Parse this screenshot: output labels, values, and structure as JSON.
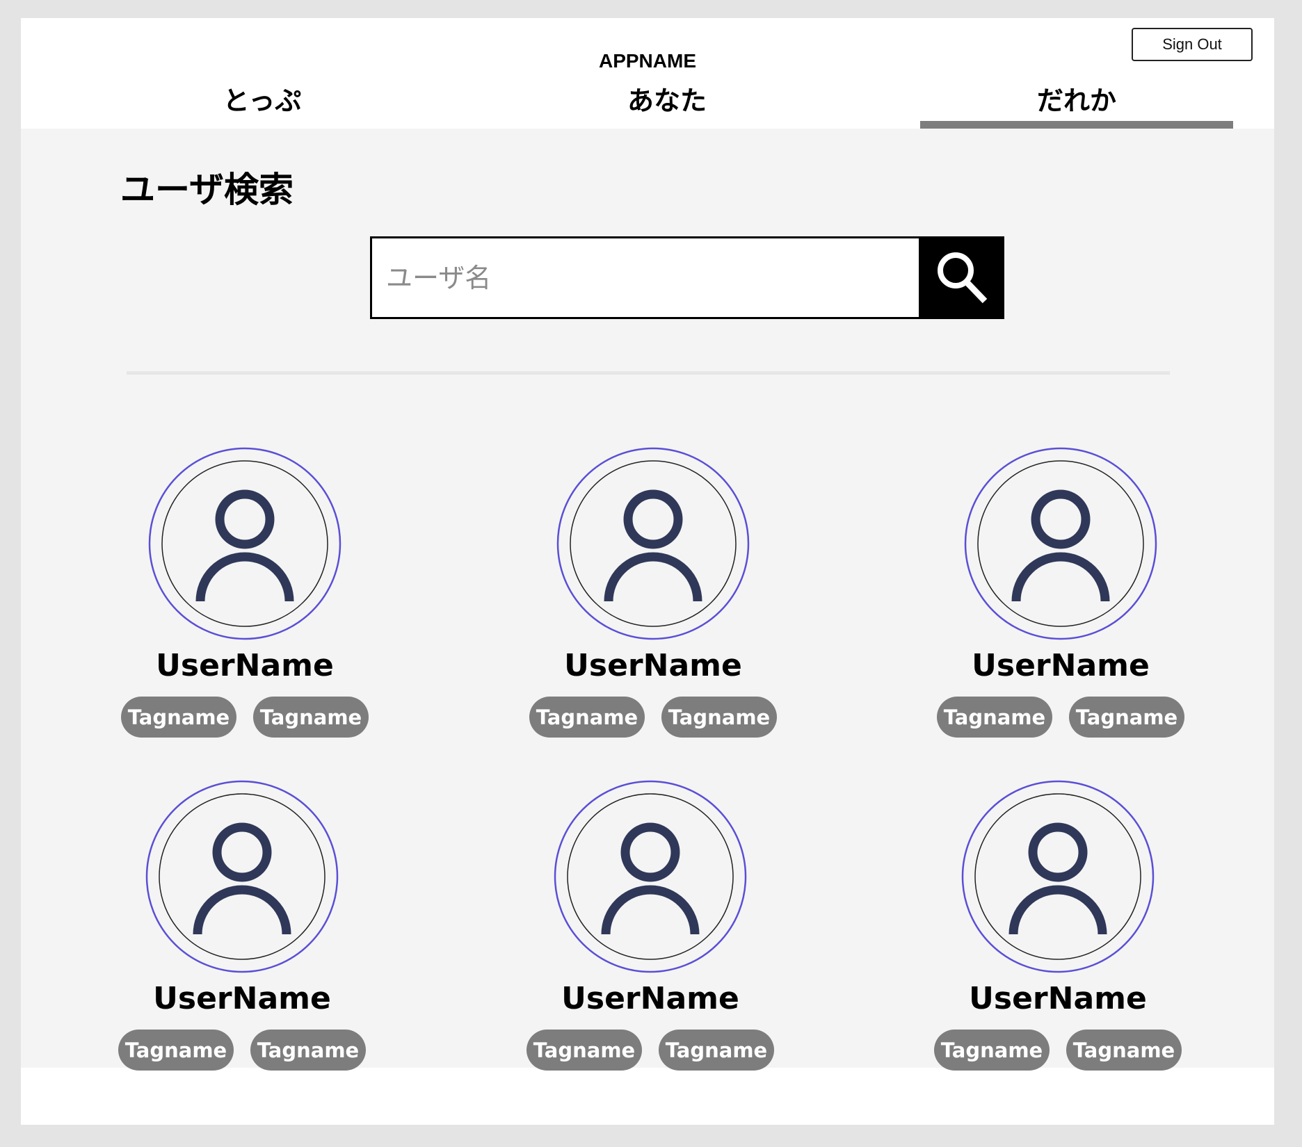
{
  "header": {
    "app_title": "APPNAME",
    "sign_out_label": "Sign Out"
  },
  "tabs": [
    {
      "label": "とっぷ",
      "active": false
    },
    {
      "label": "あなた",
      "active": false
    },
    {
      "label": "だれか",
      "active": true
    }
  ],
  "search": {
    "title": "ユーザ検索",
    "placeholder": "ユーザ名",
    "value": "",
    "button_icon": "search-icon"
  },
  "users": [
    {
      "name": "UserName",
      "tags": [
        "Tagname",
        "Tagname"
      ],
      "avatar_icon": "user-icon"
    },
    {
      "name": "UserName",
      "tags": [
        "Tagname",
        "Tagname"
      ],
      "avatar_icon": "user-icon"
    },
    {
      "name": "UserName",
      "tags": [
        "Tagname",
        "Tagname"
      ],
      "avatar_icon": "user-icon"
    },
    {
      "name": "UserName",
      "tags": [
        "Tagname",
        "Tagname"
      ],
      "avatar_icon": "user-icon"
    },
    {
      "name": "UserName",
      "tags": [
        "Tagname",
        "Tagname"
      ],
      "avatar_icon": "user-icon"
    },
    {
      "name": "UserName",
      "tags": [
        "Tagname",
        "Tagname"
      ],
      "avatar_icon": "user-icon"
    }
  ],
  "colors": {
    "page_background": "#e4e4e4",
    "content_background": "#f4f4f4",
    "tab_indicator": "#7d7d7d",
    "tag_background": "#7d7d7d",
    "avatar_outer_ring": "#5a4fd6",
    "avatar_figure": "#2f3858"
  }
}
